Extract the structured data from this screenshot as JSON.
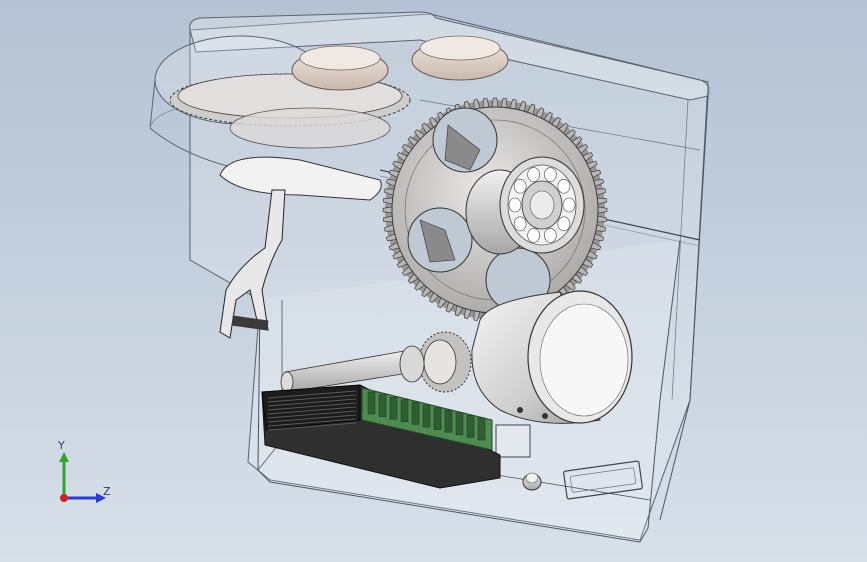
{
  "viewport": {
    "background_top": "#b4c2d3",
    "background_bottom": "#d7dfe9"
  },
  "triad": {
    "y_label": "Y",
    "z_label": "Z",
    "y_color": "#2fa52f",
    "z_color": "#2a3ad6",
    "origin_color": "#d01f1f"
  },
  "model": {
    "components": [
      "transparent-housing",
      "large-spur-gear",
      "upper-gear",
      "pulleys",
      "ball-bearing",
      "motor",
      "pinion-gear",
      "shaft",
      "terminal-block",
      "driver-board",
      "fork-bracket",
      "push-button",
      "slot-window"
    ]
  }
}
